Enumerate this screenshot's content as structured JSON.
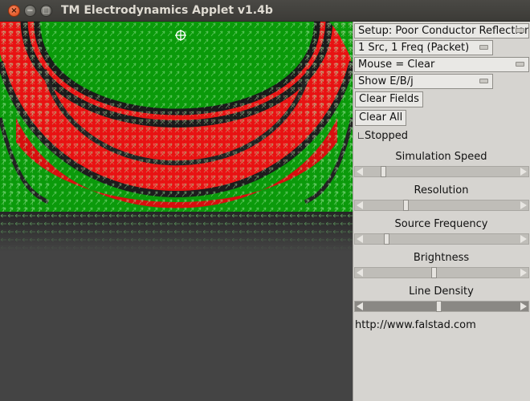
{
  "window": {
    "title": "TM Electrodynamics Applet v1.4b",
    "close_glyph": "×",
    "min_glyph": "−",
    "max_glyph": "□"
  },
  "controls": {
    "setup": "Setup: Poor Conductor Reflection",
    "source": "1 Src, 1 Freq (Packet)",
    "mouse": "Mouse = Clear",
    "show": "Show E/B/j",
    "clear_fields": "Clear Fields",
    "clear_all": "Clear All",
    "stopped": "Stopped"
  },
  "sliders": [
    {
      "label": "Simulation Speed",
      "value_fraction": 0.11
    },
    {
      "label": "Resolution",
      "value_fraction": 0.26
    },
    {
      "label": "Source Frequency",
      "value_fraction": 0.13
    },
    {
      "label": "Brightness",
      "value_fraction": 0.45
    },
    {
      "label": "Line Density",
      "value_fraction": 0.48
    }
  ],
  "footer": {
    "url": "http://www.falstad.com"
  },
  "icons": {
    "crosshair": "crosshair-icon"
  },
  "colors": {
    "field_red": "#ee1010",
    "field_green": "#0a9a0a",
    "background": "#444444",
    "panel": "#d6d4d0"
  }
}
